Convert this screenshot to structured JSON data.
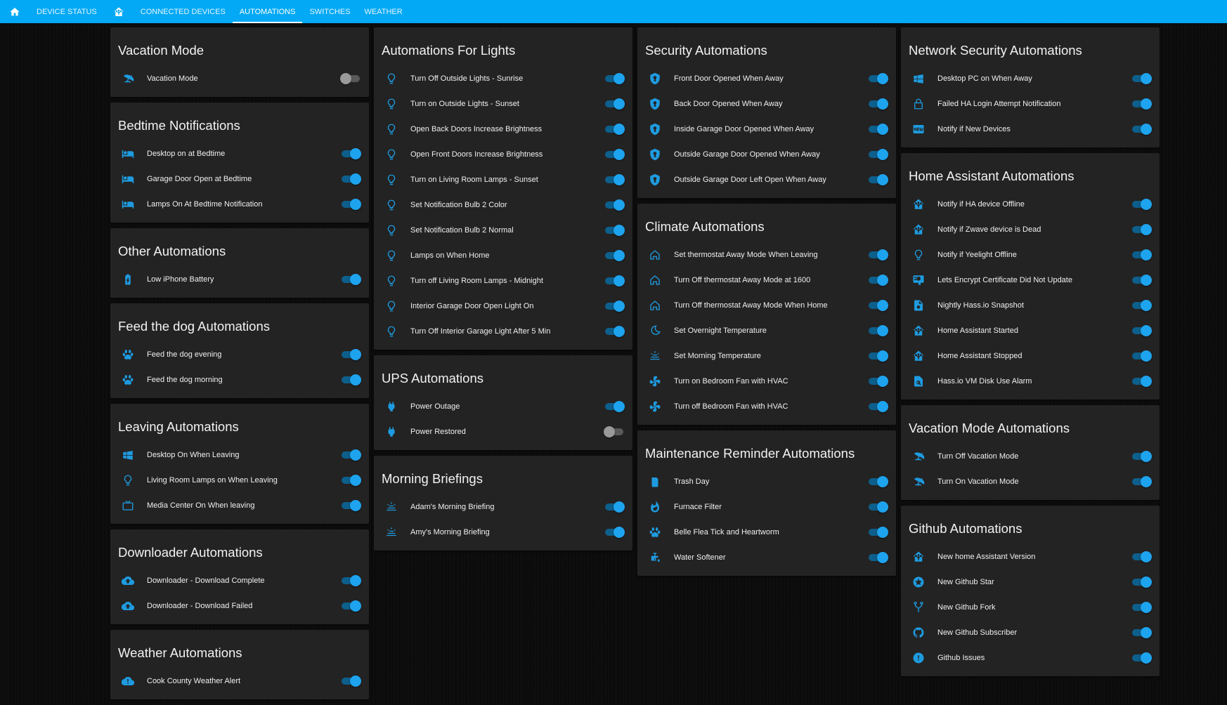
{
  "nav": {
    "tabs": [
      {
        "label": "",
        "icon": "home-icon"
      },
      {
        "label": "Device Status"
      },
      {
        "label": "",
        "icon": "home-assistant-icon"
      },
      {
        "label": "Connected Devices"
      },
      {
        "label": "Automations",
        "active": true
      },
      {
        "label": "Switches"
      },
      {
        "label": "Weather"
      }
    ]
  },
  "colors": {
    "accent": "#03a9f4",
    "icon": "#1e9be0",
    "card": "#232323"
  },
  "columns": [
    [
      {
        "title": "Vacation Mode",
        "items": [
          {
            "label": "Vacation Mode",
            "icon": "beach-icon",
            "on": false
          }
        ]
      },
      {
        "title": "Bedtime Notifications",
        "items": [
          {
            "label": "Desktop on at Bedtime",
            "icon": "bed-icon",
            "on": true
          },
          {
            "label": "Garage Door Open at Bedtime",
            "icon": "bed-icon",
            "on": true
          },
          {
            "label": "Lamps On At Bedtime Notification",
            "icon": "bed-icon",
            "on": true
          }
        ]
      },
      {
        "title": "Other Automations",
        "items": [
          {
            "label": "Low iPhone Battery",
            "icon": "battery-charging-icon",
            "on": true
          }
        ]
      },
      {
        "title": "Feed the dog Automations",
        "items": [
          {
            "label": "Feed the dog evening",
            "icon": "paw-icon",
            "on": true
          },
          {
            "label": "Feed the dog morning",
            "icon": "paw-icon",
            "on": true
          }
        ]
      },
      {
        "title": "Leaving Automations",
        "items": [
          {
            "label": "Desktop On When Leaving",
            "icon": "windows-icon",
            "on": true
          },
          {
            "label": "Living Room Lamps on When Leaving",
            "icon": "lightbulb-icon",
            "on": true
          },
          {
            "label": "Media Center On When leaving",
            "icon": "tv-icon",
            "on": true
          }
        ]
      },
      {
        "title": "Downloader Automations",
        "items": [
          {
            "label": "Downloader - Download Complete",
            "icon": "cloud-upload-icon",
            "on": true
          },
          {
            "label": "Downloader - Download Failed",
            "icon": "cloud-upload-icon",
            "on": true
          }
        ]
      },
      {
        "title": "Weather Automations",
        "items": [
          {
            "label": "Cook County Weather Alert",
            "icon": "cloud-alert-icon",
            "on": true
          }
        ]
      }
    ],
    [
      {
        "title": "Automations For Lights",
        "items": [
          {
            "label": "Turn Off Outside Lights - Sunrise",
            "icon": "lightbulb-icon",
            "on": true
          },
          {
            "label": "Turn on Outside Lights - Sunset",
            "icon": "lightbulb-icon",
            "on": true
          },
          {
            "label": "Open Back Doors Increase Brightness",
            "icon": "lightbulb-icon",
            "on": true
          },
          {
            "label": "Open Front Doors Increase Brightness",
            "icon": "lightbulb-icon",
            "on": true
          },
          {
            "label": "Turn on Living Room Lamps - Sunset",
            "icon": "lightbulb-icon",
            "on": true
          },
          {
            "label": "Set Notification Bulb 2 Color",
            "icon": "lightbulb-icon",
            "on": true
          },
          {
            "label": "Set Notification Bulb 2 Normal",
            "icon": "lightbulb-icon",
            "on": true
          },
          {
            "label": "Lamps on When Home",
            "icon": "lightbulb-icon",
            "on": true
          },
          {
            "label": "Turn off Living Room Lamps - Midnight",
            "icon": "lightbulb-icon",
            "on": true
          },
          {
            "label": "Interior Garage Door Open Light On",
            "icon": "lightbulb-icon",
            "on": true
          },
          {
            "label": "Turn Off Interior Garage Light After 5 Min",
            "icon": "lightbulb-icon",
            "on": true
          }
        ]
      },
      {
        "title": "UPS Automations",
        "items": [
          {
            "label": "Power Outage",
            "icon": "power-plug-icon",
            "on": true
          },
          {
            "label": "Power Restored",
            "icon": "power-plug-icon",
            "on": false
          }
        ]
      },
      {
        "title": "Morning Briefings",
        "items": [
          {
            "label": "Adam's Morning Briefing",
            "icon": "sunrise-icon",
            "on": true
          },
          {
            "label": "Amy's Morning Briefing",
            "icon": "sunrise-icon",
            "on": true
          }
        ]
      }
    ],
    [
      {
        "title": "Security Automations",
        "items": [
          {
            "label": "Front Door Opened When Away",
            "icon": "shield-icon",
            "on": true
          },
          {
            "label": "Back Door Opened When Away",
            "icon": "shield-icon",
            "on": true
          },
          {
            "label": "Inside Garage Door Opened When Away",
            "icon": "shield-icon",
            "on": true
          },
          {
            "label": "Outside Garage Door Opened When Away",
            "icon": "shield-icon",
            "on": true
          },
          {
            "label": "Outside Garage Door Left Open When Away",
            "icon": "shield-icon",
            "on": true
          }
        ]
      },
      {
        "title": "Climate Automations",
        "items": [
          {
            "label": "Set thermostat Away Mode When Leaving",
            "icon": "home-outline-icon",
            "on": true
          },
          {
            "label": "Turn Off thermostat Away Mode at 1600",
            "icon": "home-outline-icon",
            "on": true
          },
          {
            "label": "Turn Off thermostat Away Mode When Home",
            "icon": "home-outline-icon",
            "on": true
          },
          {
            "label": "Set Overnight Temperature",
            "icon": "moon-icon",
            "on": true
          },
          {
            "label": "Set Morning Temperature",
            "icon": "sunrise-icon",
            "on": true
          },
          {
            "label": "Turn on Bedroom Fan with HVAC",
            "icon": "fan-icon",
            "on": true
          },
          {
            "label": "Turn off Bedroom Fan with HVAC",
            "icon": "fan-icon",
            "on": true
          }
        ]
      },
      {
        "title": "Maintenance Reminder Automations",
        "items": [
          {
            "label": "Trash Day",
            "icon": "trash-icon",
            "on": true
          },
          {
            "label": "Furnace Filter",
            "icon": "fire-icon",
            "on": true
          },
          {
            "label": "Belle Flea Tick and Heartworm",
            "icon": "paw-icon",
            "on": true
          },
          {
            "label": "Water Softener",
            "icon": "water-pump-icon",
            "on": true
          }
        ]
      }
    ],
    [
      {
        "title": "Network Security Automations",
        "items": [
          {
            "label": "Desktop PC on When Away",
            "icon": "windows-icon",
            "on": true
          },
          {
            "label": "Failed HA Login Attempt Notification",
            "icon": "lock-icon",
            "on": true
          },
          {
            "label": "Notify if New Devices",
            "icon": "new-box-icon",
            "on": true
          }
        ]
      },
      {
        "title": "Home Assistant Automations",
        "items": [
          {
            "label": "Notify if HA device Offline",
            "icon": "home-assistant-icon",
            "on": true
          },
          {
            "label": "Notify if Zwave device is Dead",
            "icon": "home-assistant-icon",
            "on": true
          },
          {
            "label": "Notify if Yeelight Offline",
            "icon": "lightbulb-icon",
            "on": true
          },
          {
            "label": "Lets Encrypt Certificate Did Not Update",
            "icon": "certificate-icon",
            "on": true
          },
          {
            "label": "Nightly Hass.io Snapshot",
            "icon": "file-icon",
            "on": true
          },
          {
            "label": "Home Assistant Started",
            "icon": "home-assistant-icon",
            "on": true
          },
          {
            "label": "Home Assistant Stopped",
            "icon": "home-assistant-icon",
            "on": true
          },
          {
            "label": "Hass.io VM Disk Use Alarm",
            "icon": "file-search-icon",
            "on": true
          }
        ]
      },
      {
        "title": "Vacation Mode Automations",
        "items": [
          {
            "label": "Turn Off Vacation Mode",
            "icon": "beach-icon",
            "on": true
          },
          {
            "label": "Turn On Vacation Mode",
            "icon": "beach-icon",
            "on": true
          }
        ]
      },
      {
        "title": "Github Automations",
        "items": [
          {
            "label": "New home Assistant Version",
            "icon": "home-assistant-icon",
            "on": true
          },
          {
            "label": "New Github Star",
            "icon": "star-circle-icon",
            "on": true
          },
          {
            "label": "New Github Fork",
            "icon": "fork-icon",
            "on": true
          },
          {
            "label": "New Github Subscriber",
            "icon": "github-icon",
            "on": true
          },
          {
            "label": "Github Issues",
            "icon": "alert-circle-icon",
            "on": true
          }
        ]
      }
    ]
  ]
}
